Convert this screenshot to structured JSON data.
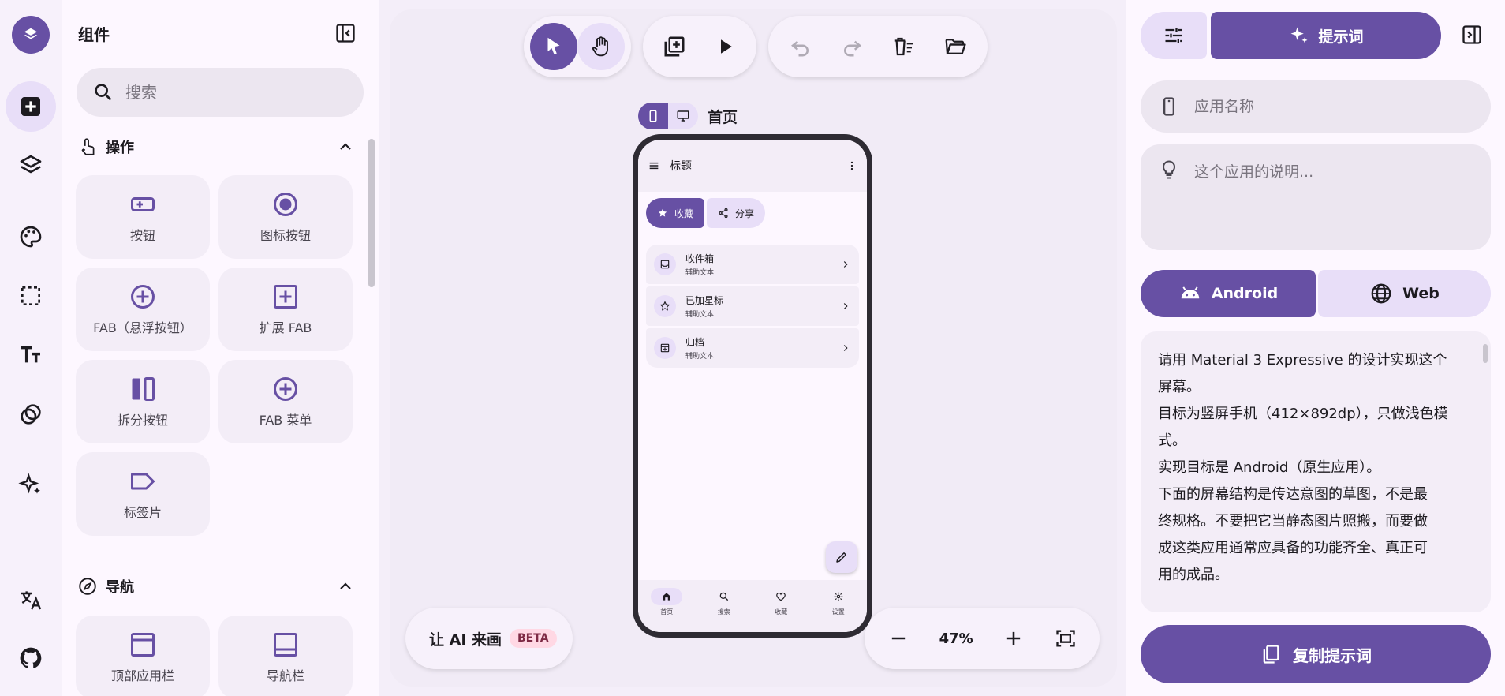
{
  "colors": {
    "primary": "#6750a4",
    "primary_container": "#e8def8",
    "surface": "#fdf7ff",
    "canvas": "#f1ebf6",
    "beta_bg": "#ffd8e4"
  },
  "panel": {
    "title": "组件",
    "search_placeholder": "搜索",
    "sections": [
      {
        "label": "操作",
        "icon": "touch-icon",
        "items": [
          {
            "label": "按钮",
            "icon": "button-icon"
          },
          {
            "label": "图标按钮",
            "icon": "radio-icon"
          },
          {
            "label": "FAB（悬浮按钮）",
            "icon": "add-circle-icon"
          },
          {
            "label": "扩展 FAB",
            "icon": "add-box-icon"
          },
          {
            "label": "拆分按钮",
            "icon": "split-icon"
          },
          {
            "label": "FAB 菜单",
            "icon": "add-circle-icon"
          },
          {
            "label": "标签片",
            "icon": "label-icon"
          }
        ]
      },
      {
        "label": "导航",
        "icon": "explore-icon",
        "items": [
          {
            "label": "顶部应用栏",
            "icon": "top-bar-icon"
          },
          {
            "label": "导航栏",
            "icon": "bottom-bar-icon"
          }
        ]
      }
    ]
  },
  "canvas": {
    "screen_name": "首页",
    "ai": {
      "label": "让 AI 来画",
      "badge": "BETA"
    },
    "zoom": "47%"
  },
  "phone": {
    "title": "标题",
    "chips": [
      "收藏",
      "分享"
    ],
    "list": [
      {
        "title": "收件箱",
        "subtitle": "辅助文本",
        "icon": "inbox-icon"
      },
      {
        "title": "已加星标",
        "subtitle": "辅助文本",
        "icon": "star-icon"
      },
      {
        "title": "归档",
        "subtitle": "辅助文本",
        "icon": "archive-icon"
      }
    ],
    "nav": [
      "首页",
      "搜索",
      "收藏",
      "设置"
    ]
  },
  "right": {
    "tab_prompt": "提示词",
    "app_name_placeholder": "应用名称",
    "desc_placeholder": "这个应用的说明...",
    "platforms": [
      "Android",
      "Web"
    ],
    "prompt_lines": [
      "请用 Material 3 Expressive 的设计实现这个",
      "屏幕。",
      "目标为竖屏手机（412×892dp），只做浅色模",
      "式。",
      "实现目标是 Android（原生应用）。",
      "下面的屏幕结构是传达意图的草图，不是最",
      "终规格。不要把它当静态图片照搬，而要做",
      "成这类应用通常应具备的功能齐全、真正可",
      "用的成品。"
    ],
    "copy_label": "复制提示词"
  }
}
